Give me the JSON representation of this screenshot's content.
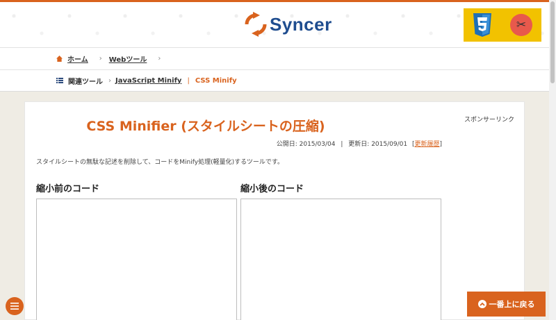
{
  "header": {
    "logo_text": "Syncer",
    "logo_color": "#1f4d8f",
    "accent_color": "#d9631e",
    "banner_icons": [
      "css3-icon",
      "scissors-icon"
    ]
  },
  "breadcrumb": {
    "home": "ホーム",
    "web_tools": "Webツール",
    "related": "関連ツール",
    "javascript_minify": "JavaScript Minify",
    "separator": "|",
    "current": "CSS Minify"
  },
  "main": {
    "title": "CSS Minifier (スタイルシートの圧縮)",
    "published": "公開日: 2015/03/04",
    "date_sep": "|",
    "updated": "更新日: 2015/09/01",
    "history_link": "更新履歴",
    "description": "スタイルシートの無駄な記述を削除して、コードをMinify処理(軽量化)するツールです。",
    "input_label": "縮小前のコード",
    "output_label": "縮小後のコード",
    "input_value": "",
    "output_value": ""
  },
  "sidebar": {
    "sponsor_label": "スポンサーリンク"
  },
  "footer": {
    "back_to_top": "一番上に戻る"
  }
}
